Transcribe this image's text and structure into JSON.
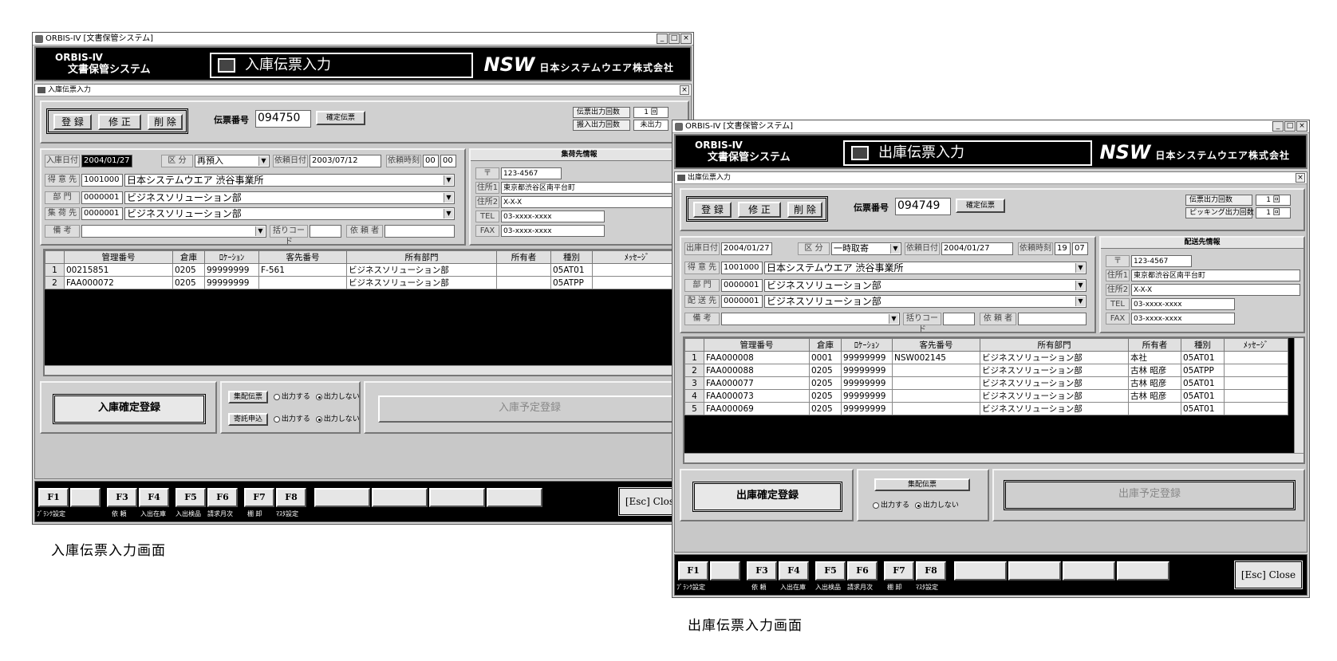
{
  "caption_in": "入庫伝票入力画面",
  "caption_out": "出庫伝票入力画面",
  "app": {
    "window_title": "ORBIS-IV [文書保管システム]",
    "logo_line1": "ORBIS-Ⅳ",
    "logo_line2": "文書保管システム",
    "nsw": "NSW",
    "company": "日本システムウエア株式会社",
    "winbtn_min": "_",
    "winbtn_max": "□",
    "winbtn_close": "×"
  },
  "in": {
    "title": "入庫伝票入力",
    "form_title": "入庫伝票入力",
    "buttons": {
      "register": "登 録",
      "modify": "修 正",
      "delete": "削 除"
    },
    "slip_label": "伝票番号",
    "slip_no": "094750",
    "confirm_btn": "確定伝票",
    "counter1_label": "伝票出力回数",
    "counter1_value": "1 回",
    "counter2_label": "搬入出力回数",
    "counter2_value": "未出力",
    "f_date_label": "入庫日付",
    "f_date": "2004/01/27",
    "f_kubun_label": "区 分",
    "f_kubun": "再預入",
    "f_reqdate_label": "依頼日付",
    "f_reqdate": "2003/07/12",
    "f_reqtime_label": "依頼時刻",
    "f_hh": "00",
    "f_mm": "00",
    "f_customer_label": "得 意 先",
    "f_customer_code": "1001000",
    "f_customer_name": "日本システムウエア 渋谷事業所",
    "f_dept_label": "部 門",
    "f_dept_code": "0000001",
    "f_dept_name": "ビジネスソリューション部",
    "f_dest_label": "集 荷 先",
    "f_dest_code": "0000001",
    "f_dest_name": "ビジネスソリューション部",
    "f_note_label": "備 考",
    "f_barcode_label": "括りコード",
    "f_requester_label": "依 頼 者",
    "side_title": "集荷先情報",
    "zip_label": "〒",
    "zip": "123-4567",
    "addr1_label": "住所1",
    "addr1": "東京都渋谷区南平台町",
    "addr2_label": "住所2",
    "addr2": "X-X-X",
    "tel_label": "TEL",
    "tel": "03-xxxx-xxxx",
    "fax_label": "FAX",
    "fax": "03-xxxx-xxxx",
    "columns": [
      "",
      "管理番号",
      "倉庫",
      "ﾛｹｰｼｮﾝ",
      "客先番号",
      "所有部門",
      "所有者",
      "種別",
      "ﾒｯｾｰｼﾞ"
    ],
    "rows": [
      [
        "1",
        "00215851",
        "0205",
        "99999999",
        "F-561",
        "ビジネスソリューション部",
        "",
        "05AT01",
        ""
      ],
      [
        "2",
        "FAA000072",
        "0205",
        "99999999",
        "",
        "ビジネスソリューション部",
        "",
        "05ATPP",
        ""
      ]
    ],
    "big_confirm": "入庫確定登録",
    "opt1_btn": "集配伝票",
    "opt1_yes": "出力する",
    "opt1_no": "出力しない",
    "opt2_btn": "寄託申込",
    "opt2_yes": "出力する",
    "opt2_no": "出力しない",
    "big_plan": "入庫予定登録"
  },
  "out": {
    "title": "出庫伝票入力",
    "form_title": "出庫伝票入力",
    "buttons": {
      "register": "登 録",
      "modify": "修 正",
      "delete": "削 除"
    },
    "slip_label": "伝票番号",
    "slip_no": "094749",
    "confirm_btn": "確定伝票",
    "counter1_label": "伝票出力回数",
    "counter1_value": "1 回",
    "counter2_label": "ピッキング出力回数",
    "counter2_value": "1 回",
    "f_date_label": "出庫日付",
    "f_date": "2004/01/27",
    "f_kubun_label": "区 分",
    "f_kubun": "一時取寄",
    "f_reqdate_label": "依頼日付",
    "f_reqdate": "2004/01/27",
    "f_reqtime_label": "依頼時刻",
    "f_hh": "19",
    "f_mm": "07",
    "f_customer_label": "得 意 先",
    "f_customer_code": "1001000",
    "f_customer_name": "日本システムウエア 渋谷事業所",
    "f_dept_label": "部 門",
    "f_dept_code": "0000001",
    "f_dept_name": "ビジネスソリューション部",
    "f_dest_label": "配 送 先",
    "f_dest_code": "0000001",
    "f_dest_name": "ビジネスソリューション部",
    "f_note_label": "備 考",
    "f_barcode_label": "括りコード",
    "f_requester_label": "依 頼 者",
    "side_title": "配送先情報",
    "zip_label": "〒",
    "zip": "123-4567",
    "addr1_label": "住所1",
    "addr1": "東京都渋谷区南平台町",
    "addr2_label": "住所2",
    "addr2": "X-X-X",
    "tel_label": "TEL",
    "tel": "03-xxxx-xxxx",
    "fax_label": "FAX",
    "fax": "03-xxxx-xxxx",
    "columns": [
      "",
      "管理番号",
      "倉庫",
      "ﾛｹｰｼｮﾝ",
      "客先番号",
      "所有部門",
      "所有者",
      "種別",
      "ﾒｯｾｰｼﾞ"
    ],
    "rows": [
      [
        "1",
        "FAA000008",
        "0001",
        "99999999",
        "NSW002145",
        "ビジネスソリューション部",
        "本社",
        "05AT01",
        ""
      ],
      [
        "2",
        "FAA000088",
        "0205",
        "99999999",
        "",
        "ビジネスソリューション部",
        "古林 昭彦",
        "05ATPP",
        ""
      ],
      [
        "3",
        "FAA000077",
        "0205",
        "99999999",
        "",
        "ビジネスソリューション部",
        "古林 昭彦",
        "05AT01",
        ""
      ],
      [
        "4",
        "FAA000073",
        "0205",
        "99999999",
        "",
        "ビジネスソリューション部",
        "古林 昭彦",
        "05AT01",
        ""
      ],
      [
        "5",
        "FAA000069",
        "0205",
        "99999999",
        "",
        "ビジネスソリューション部",
        "",
        "05AT01",
        ""
      ]
    ],
    "big_confirm": "出庫確定登録",
    "opt1_btn": "集配伝票",
    "opt1_yes": "出力する",
    "opt1_no": "出力しない",
    "big_plan": "出庫予定登録"
  },
  "fkeys": {
    "keys": [
      "F1",
      "",
      "F3",
      "F4",
      "F5",
      "F6",
      "F7",
      "F8",
      "",
      "",
      "",
      ""
    ],
    "captions": [
      "ﾌﾞﾗﾝｸ設定",
      "依 頼",
      "入出在庫",
      "入出検品",
      "請求月次",
      "棚 卸",
      "ﾏｽﾀ設定"
    ],
    "esc": "[Esc] Close"
  }
}
